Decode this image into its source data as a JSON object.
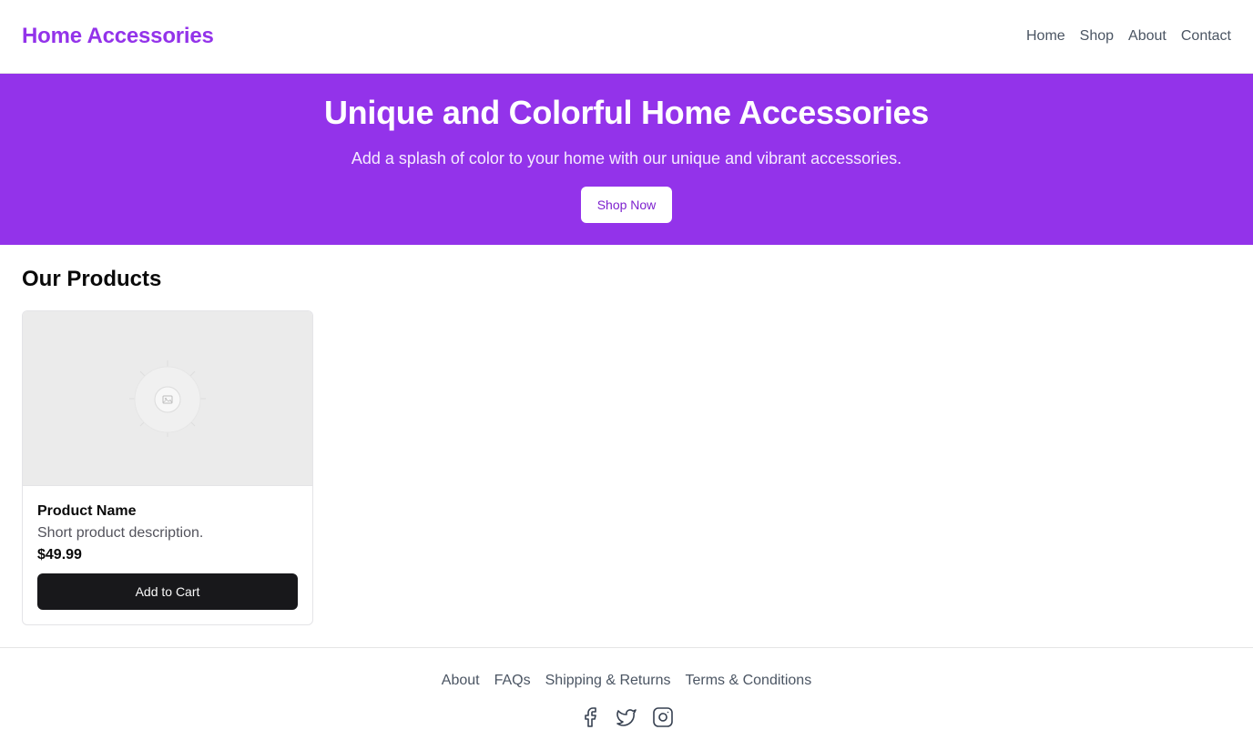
{
  "header": {
    "brand": "Home Accessories",
    "nav": [
      "Home",
      "Shop",
      "About",
      "Contact"
    ]
  },
  "hero": {
    "title": "Unique and Colorful Home Accessories",
    "subtitle": "Add a splash of color to your home with our unique and vibrant accessories.",
    "cta_label": "Shop Now"
  },
  "products": {
    "title": "Our Products",
    "items": [
      {
        "name": "Product Name",
        "description": "Short product description.",
        "price": "$49.99",
        "button_label": "Add to Cart",
        "image_icon": "image-placeholder-icon"
      }
    ]
  },
  "footer": {
    "links": [
      "About",
      "FAQs",
      "Shipping & Returns",
      "Terms & Conditions"
    ],
    "social_icons": [
      "facebook-icon",
      "twitter-icon",
      "instagram-icon"
    ]
  },
  "colors": {
    "brand": "#9333ea",
    "hero_background": "#9333ea",
    "button_dark": "#18181b",
    "muted_text": "#4b5563"
  }
}
